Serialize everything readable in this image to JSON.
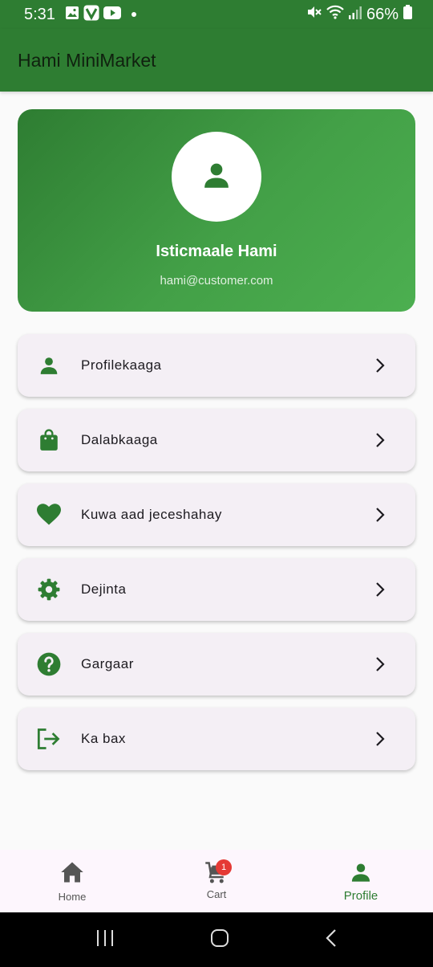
{
  "status_bar": {
    "time": "5:31",
    "battery": "66%",
    "icons": [
      "gallery-icon",
      "v-app-icon",
      "youtube-icon",
      "mute-icon",
      "wifi-icon",
      "signal-icon",
      "battery-icon"
    ]
  },
  "app_bar": {
    "title": "Hami MiniMarket"
  },
  "profile": {
    "name": "Isticmaale Hami",
    "email": "hami@customer.com",
    "avatar_icon": "person-icon"
  },
  "menu": [
    {
      "label": "Profilekaaga",
      "icon": "person-icon"
    },
    {
      "label": "Dalabkaaga",
      "icon": "shopping-bag-icon"
    },
    {
      "label": "Kuwa aad jeceshahay",
      "icon": "heart-icon"
    },
    {
      "label": "Dejinta",
      "icon": "settings-icon"
    },
    {
      "label": "Gargaar",
      "icon": "help-icon"
    },
    {
      "label": "Ka bax",
      "icon": "logout-icon"
    }
  ],
  "bottom_nav": {
    "items": [
      {
        "label": "Home",
        "icon": "home-icon"
      },
      {
        "label": "Cart",
        "icon": "cart-icon",
        "badge": "1"
      },
      {
        "label": "Profile",
        "icon": "person-icon",
        "active": true
      }
    ]
  },
  "colors": {
    "primary": "#2e7d32",
    "primary_light": "#4caf50",
    "menu_bg": "#f4eff5",
    "badge": "#e53935"
  }
}
